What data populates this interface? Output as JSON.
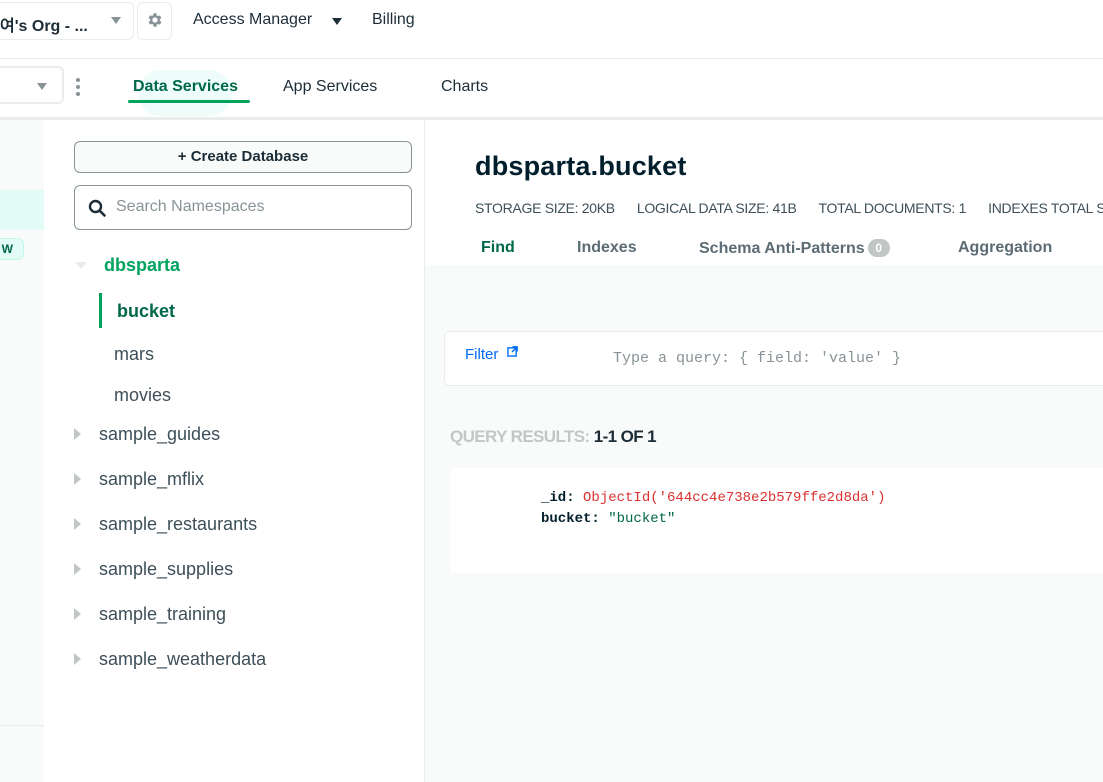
{
  "topbar": {
    "org_name": "여's Org - ...",
    "access_manager": "Access Manager",
    "billing": "Billing"
  },
  "nav": {
    "tabs": [
      {
        "label": "Data Services",
        "active": true
      },
      {
        "label": "App Services",
        "active": false
      },
      {
        "label": "Charts",
        "active": false
      }
    ]
  },
  "left_strip": {
    "badge": "W"
  },
  "sidebar": {
    "create_database": "Create Database",
    "create_icon": "+",
    "search_placeholder": "Search Namespaces",
    "databases": [
      {
        "name": "dbsparta",
        "expanded": true,
        "collections": [
          "bucket",
          "mars",
          "movies"
        ],
        "active_collection": "bucket"
      },
      {
        "name": "sample_guides",
        "expanded": false
      },
      {
        "name": "sample_mflix",
        "expanded": false
      },
      {
        "name": "sample_restaurants",
        "expanded": false
      },
      {
        "name": "sample_supplies",
        "expanded": false
      },
      {
        "name": "sample_training",
        "expanded": false
      },
      {
        "name": "sample_weatherdata",
        "expanded": false
      }
    ]
  },
  "main": {
    "title": "dbsparta.bucket",
    "stats": [
      {
        "label": "STORAGE SIZE:",
        "value": "20KB"
      },
      {
        "label": "LOGICAL DATA SIZE:",
        "value": "41B"
      },
      {
        "label": "TOTAL DOCUMENTS:",
        "value": "1"
      },
      {
        "label": "INDEXES TOTAL S",
        "value": ""
      }
    ],
    "tabs": [
      {
        "label": "Find",
        "active": true
      },
      {
        "label": "Indexes",
        "active": false
      },
      {
        "label": "Schema Anti-Patterns",
        "count": "0",
        "active": false
      },
      {
        "label": "Aggregation",
        "active": false
      }
    ],
    "filter": {
      "label": "Filter",
      "placeholder": "Type a query: { field: 'value' }"
    },
    "results": {
      "label": "QUERY RESULTS:",
      "count": "1-1 OF 1"
    },
    "document": {
      "id_key": "_id:",
      "id_value": "ObjectId('644cc4e738e2b579ffe2d8da')",
      "bucket_key": "bucket:",
      "bucket_value": "\"bucket\""
    }
  },
  "colors": {
    "accent_green": "#00a35c",
    "dark_green": "#00684a",
    "link_blue": "#016bf8",
    "objectid_red": "#db3030"
  }
}
